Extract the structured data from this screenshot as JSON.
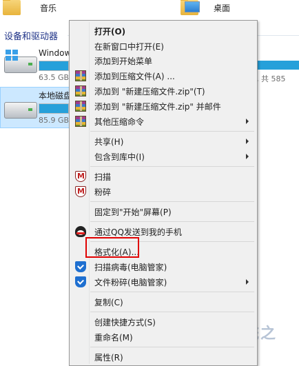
{
  "explorer": {
    "top_items": [
      {
        "label": "音乐",
        "icon": "music-folder-icon"
      },
      {
        "label": "桌面",
        "icon": "desktop-folder-icon"
      }
    ],
    "section_title": "设备和驱动器",
    "drives": [
      {
        "name": "Window",
        "size_text": "63.5 GB",
        "right_text": ", 共 585",
        "usage": 0.85
      },
      {
        "name": "本地磁盘",
        "size_text": "85.9 GB",
        "usage": 0.6
      }
    ]
  },
  "watermark": {
    "text": "系统之"
  },
  "context_menu": {
    "items": [
      {
        "label": "打开(O)",
        "bold": true
      },
      {
        "label": "在新窗口中打开(E)"
      },
      {
        "label": "添加到开始菜单"
      },
      {
        "label": "添加到压缩文件(A) ...",
        "icon": "winrar-icon"
      },
      {
        "label": "添加到 \"新建压缩文件.zip\"(T)",
        "icon": "winrar-icon"
      },
      {
        "label": "添加到 \"新建压缩文件.zip\" 并邮件",
        "icon": "winrar-icon"
      },
      {
        "label": "其他压缩命令",
        "icon": "winrar-icon",
        "submenu": true
      },
      {
        "label": "共享(H)",
        "submenu": true
      },
      {
        "label": "包含到库中(I)",
        "submenu": true
      },
      {
        "label": "扫描",
        "icon": "shield-icon"
      },
      {
        "label": "粉碎",
        "icon": "shield-icon"
      },
      {
        "label": "固定到\"开始\"屏幕(P)"
      },
      {
        "label": "通过QQ发送到我的手机",
        "icon": "qq-icon"
      },
      {
        "label": "格式化(A)..."
      },
      {
        "label": "扫描病毒(电脑管家)",
        "icon": "tencent-icon"
      },
      {
        "label": "文件粉碎(电脑管家)",
        "icon": "tencent-icon",
        "submenu": true
      },
      {
        "label": "复制(C)"
      },
      {
        "label": "创建快捷方式(S)"
      },
      {
        "label": "重命名(M)"
      },
      {
        "label": "属性(R)"
      }
    ]
  },
  "colors": {
    "highlight": "#e00000",
    "accent_bar": "#26a0da",
    "selection": "#cce8ff"
  }
}
